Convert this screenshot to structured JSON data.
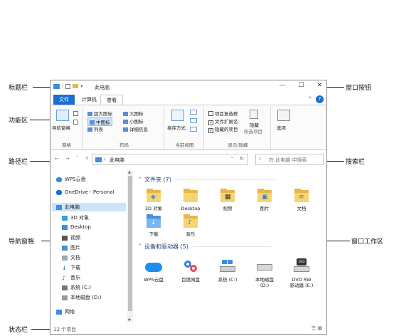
{
  "annotations": {
    "title_bar": "标题栏",
    "window_buttons": "窗口按钮",
    "ribbon": "功能区",
    "address_bar": "路径栏",
    "search_bar": "搜索栏",
    "nav_pane": "导航窗格",
    "work_area": "窗口工作区",
    "status_bar": "状态栏"
  },
  "window": {
    "title": "此电脑",
    "btn_min": "—",
    "btn_max": "☐",
    "btn_close": "✕"
  },
  "tabs": {
    "file": "文件",
    "computer": "计算机",
    "view": "查看"
  },
  "ribbon": {
    "nav_pane_btn": "导航窗格",
    "pane_group": "窗格",
    "layout": {
      "extra_large": "超大图标",
      "large": "大图标",
      "medium": "中图标",
      "small": "小图标",
      "list": "列表",
      "details": "详细信息",
      "group_label": "布局"
    },
    "current_view": {
      "sort_by": "排序方式",
      "group_label": "当前视图"
    },
    "show_hide": {
      "item_checkboxes": "项目复选框",
      "file_ext": "文件扩展名",
      "hidden_items": "隐藏的项目",
      "hide": "隐藏",
      "selected_items": "所选项目",
      "group_label": "显示/隐藏"
    },
    "options": "选项"
  },
  "address": {
    "path": "此电脑",
    "search_placeholder": "在 此电脑 中搜索"
  },
  "nav": {
    "wps": "WPS云盘",
    "onedrive": "OneDrive - Personal",
    "this_pc": "此电脑",
    "obj3d": "3D 对象",
    "desktop": "Desktop",
    "video": "视频",
    "pictures": "图片",
    "docs": "文档",
    "downloads": "下载",
    "music": "音乐",
    "sys_c": "系统 (C:)",
    "local_d": "本地磁盘 (D:)",
    "network": "网络"
  },
  "content": {
    "folders_header": "文件夹 (7)",
    "folders": [
      "3D 对象",
      "Desktop",
      "视频",
      "图片",
      "文档",
      "下载",
      "音乐"
    ],
    "devices_header": "设备和驱动器 (5)",
    "devices": [
      "WPS云盘",
      "百度网盘",
      "系统 (C:)",
      "本地磁盘\n(D:)",
      "DVD RW\n驱动器 (E:)"
    ]
  },
  "status": {
    "count": "12 个项目"
  },
  "colors": {
    "accent": "#1a6fcf",
    "folder": "#e8b54a",
    "selection": "#cce4f7"
  }
}
